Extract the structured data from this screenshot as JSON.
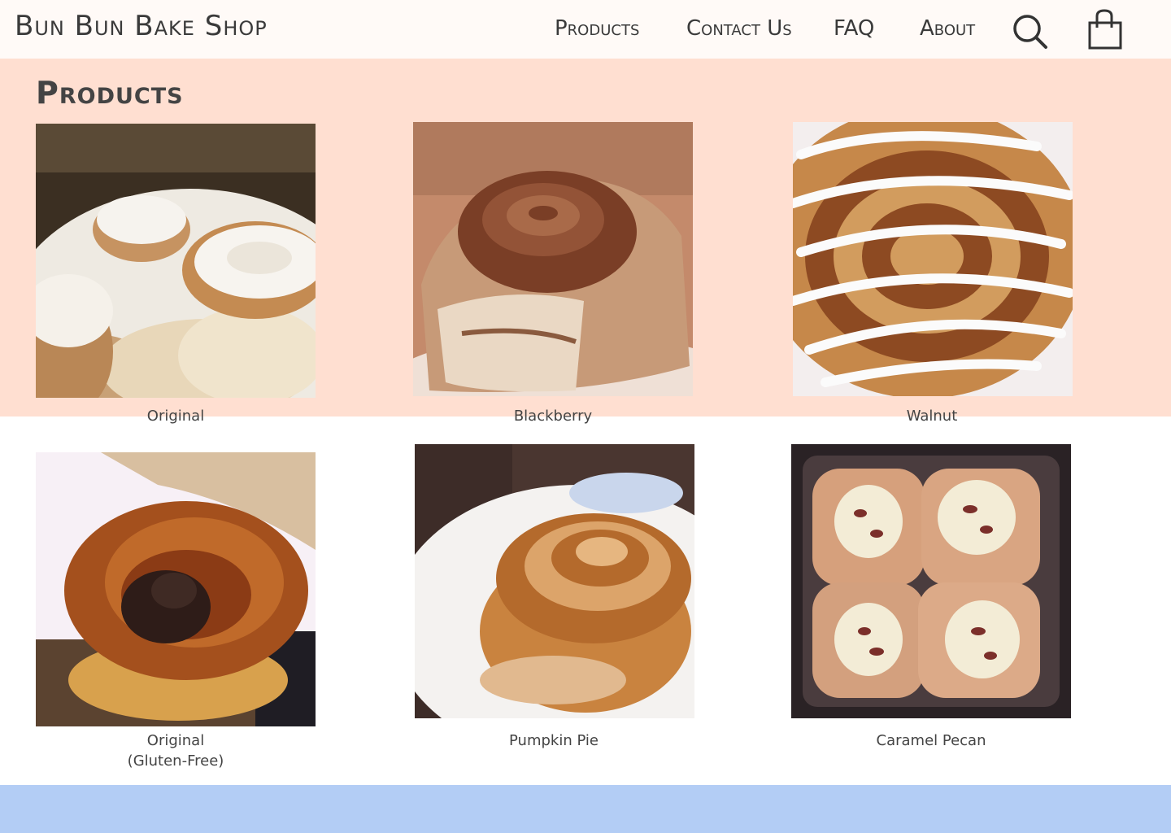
{
  "header": {
    "brand": "Bun Bun Bake Shop",
    "nav": [
      {
        "label": "Products"
      },
      {
        "label": "Contact Us"
      },
      {
        "label": "FAQ"
      },
      {
        "label": "About"
      }
    ],
    "icons": {
      "search": "search-icon",
      "cart": "shopping-bag-icon"
    }
  },
  "main": {
    "title": "Products",
    "items": [
      {
        "name": "Original"
      },
      {
        "name": "Blackberry"
      },
      {
        "name": "Walnut"
      },
      {
        "name_line1": "Original",
        "name_line2": "(Gluten-Free)"
      },
      {
        "name": "Pumpkin Pie"
      },
      {
        "name": "Caramel Pecan"
      }
    ]
  },
  "colors": {
    "header_bg": "#fffaf7",
    "band_bg": "#ffdfd1",
    "footer_bg": "#b3cdf5",
    "text": "#3a3a3a"
  }
}
